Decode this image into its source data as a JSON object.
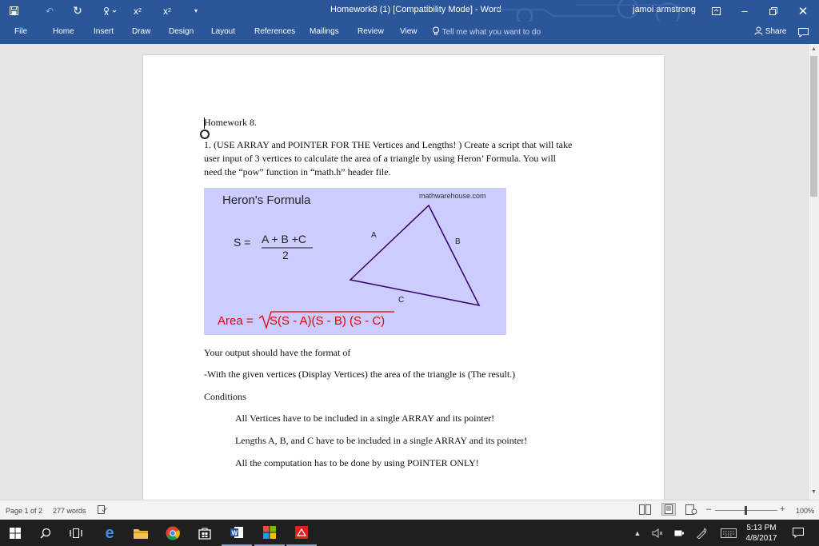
{
  "window": {
    "title": "Homework8 (1) [Compatibility Mode]  -  Word",
    "user": "jamoi armstrong"
  },
  "ribbon": {
    "tabs": [
      "File",
      "Home",
      "Insert",
      "Draw",
      "Design",
      "Layout",
      "References",
      "Mailings",
      "Review",
      "View"
    ],
    "tell_me": "Tell me what you want to do",
    "share": "Share"
  },
  "document": {
    "heading": "Homework 8.",
    "question_lines": [
      "1. (USE ARRAY and POINTER FOR THE Vertices and Lengths! )  Create a script that will take",
      "user input of 3 vertices to calculate the area of a triangle by using Heron’ Formula. You will",
      "need the “pow” function in “math.h” header file."
    ],
    "figure": {
      "title": "Heron's Formula",
      "source": "mathwarehouse.com",
      "s_label": "S =",
      "s_numerator": "A + B +C",
      "s_denominator": "2",
      "area_label": "Area  =",
      "area_expression": "S(S - A)(S - B) (S  - C)",
      "side_labels": [
        "A",
        "B",
        "C"
      ],
      "background_color": "#ccccff",
      "formula_color": "#e00000",
      "triangle_color": "#330066"
    },
    "output_intro": "Your output should have the format of",
    "output_format": "-With the given vertices (Display Vertices) the area of the triangle is (The result.)",
    "conditions_heading": "Conditions",
    "conditions": [
      "All Vertices have to be included in a single ARRAY and its pointer!",
      "Lengths A, B, and C have to be included in a single ARRAY and its pointer!",
      "All the computation has to be done by using POINTER ONLY!"
    ]
  },
  "status": {
    "page": "Page 1 of 2",
    "words": "277 words",
    "zoom": "100%"
  },
  "taskbar": {
    "time": "5:13 PM",
    "date": "4/8/2017"
  },
  "colors": {
    "word_blue": "#2b579a",
    "taskbar": "#1f1f1f"
  }
}
